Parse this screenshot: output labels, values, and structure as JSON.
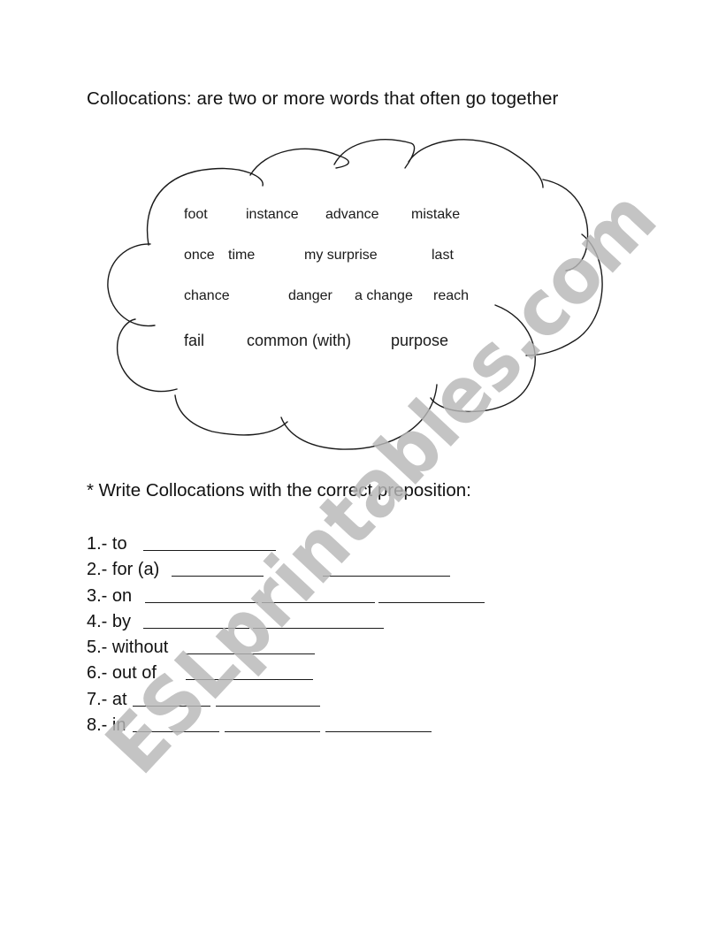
{
  "document": {
    "title": "Collocations: are two or more words that often go together",
    "word_cloud": {
      "rows": [
        [
          "foot",
          "instance",
          "advance",
          "mistake"
        ],
        [
          "once",
          "time",
          "my surprise",
          "last"
        ],
        [
          "chance",
          "danger",
          "a change",
          "reach"
        ],
        [
          "fail",
          "common (with)",
          "purpose"
        ]
      ]
    },
    "instruction": "* Write Collocations with the correct preposition:",
    "exercises": [
      {
        "label": "1.- to",
        "blanks": 1
      },
      {
        "label": "2.- for (a)",
        "blanks": 2
      },
      {
        "label": "3.- on",
        "blanks": 3
      },
      {
        "label": "4.- by",
        "blanks": 2
      },
      {
        "label": "5.- without",
        "blanks": 1
      },
      {
        "label": "6.- out of",
        "blanks": 1
      },
      {
        "label": "7.- at",
        "blanks": 2
      },
      {
        "label": "8.- in",
        "blanks": 3
      }
    ],
    "watermark": "ESLprintables.com"
  },
  "colors": {
    "text": "#111111",
    "watermark": "#b8b8b8",
    "background": "#ffffff"
  }
}
